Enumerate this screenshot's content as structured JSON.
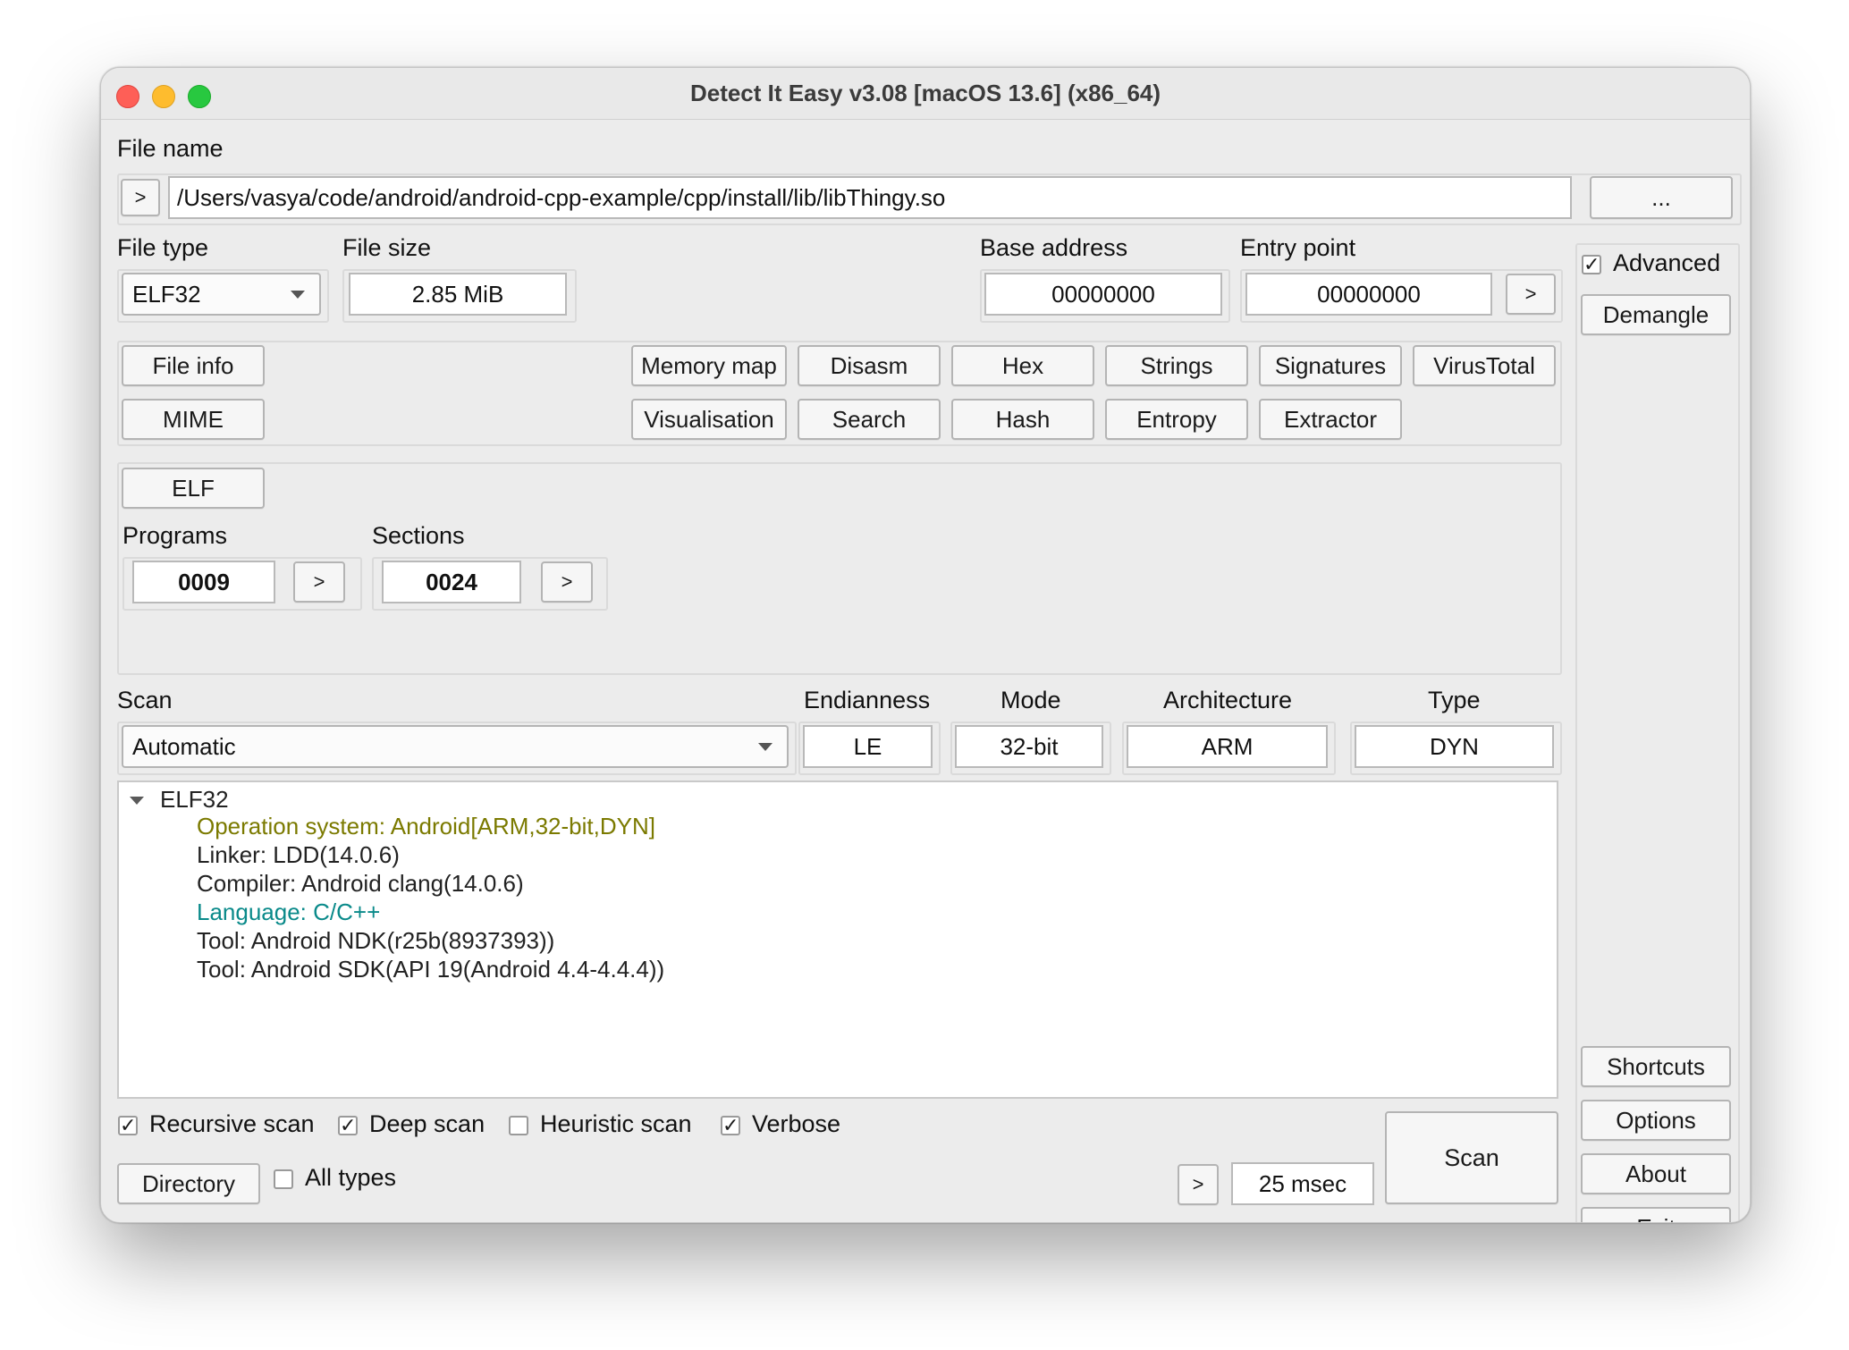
{
  "window": {
    "title": "Detect It Easy v3.08 [macOS 13.6] (x86_64)"
  },
  "file": {
    "label": "File name",
    "arrow_label": ">",
    "path": "/Users/vasya/code/android/android-cpp-example/cpp/install/lib/libThingy.so",
    "browse_label": "..."
  },
  "info": {
    "file_type_label": "File type",
    "file_type_value": "ELF32",
    "file_size_label": "File size",
    "file_size_value": "2.85 MiB",
    "base_address_label": "Base address",
    "base_address_value": "00000000",
    "entry_point_label": "Entry point",
    "entry_point_value": "00000000",
    "entry_arrow": ">"
  },
  "side": {
    "advanced_label": "Advanced",
    "advanced_checked": true,
    "demangle": "Demangle",
    "shortcuts": "Shortcuts",
    "options": "Options",
    "about": "About",
    "exit": "Exit"
  },
  "tools": {
    "file_info": "File info",
    "mime": "MIME",
    "memory_map": "Memory map",
    "disasm": "Disasm",
    "hex": "Hex",
    "strings": "Strings",
    "signatures": "Signatures",
    "virustotal": "VirusTotal",
    "visualisation": "Visualisation",
    "search": "Search",
    "hash": "Hash",
    "entropy": "Entropy",
    "extractor": "Extractor"
  },
  "elf": {
    "button": "ELF",
    "programs_label": "Programs",
    "programs_value": "0009",
    "programs_arrow": ">",
    "sections_label": "Sections",
    "sections_value": "0024",
    "sections_arrow": ">"
  },
  "scan": {
    "label": "Scan",
    "mode_value": "Automatic",
    "endianness_label": "Endianness",
    "endianness_value": "LE",
    "mode_label": "Mode",
    "bits_value": "32-bit",
    "architecture_label": "Architecture",
    "architecture_value": "ARM",
    "type_label": "Type",
    "type_value": "DYN"
  },
  "results": {
    "root": "ELF32",
    "items": [
      {
        "text": "Operation system: Android[ARM,32-bit,DYN]",
        "color": "#7b7a00"
      },
      {
        "text": "Linker: LDD(14.0.6)",
        "color": "#222222"
      },
      {
        "text": "Compiler: Android clang(14.0.6)",
        "color": "#222222"
      },
      {
        "text": "Language: C/C++",
        "color": "#0a8a8a"
      },
      {
        "text": "Tool: Android NDK(r25b(8937393))",
        "color": "#222222"
      },
      {
        "text": "Tool: Android SDK(API 19(Android 4.4-4.4.4))",
        "color": "#222222"
      }
    ]
  },
  "options": {
    "recursive": {
      "label": "Recursive scan",
      "checked": true
    },
    "deep": {
      "label": "Deep scan",
      "checked": true
    },
    "heuristic": {
      "label": "Heuristic scan",
      "checked": false
    },
    "verbose": {
      "label": "Verbose",
      "checked": true
    },
    "all_types": {
      "label": "All types",
      "checked": false
    }
  },
  "footer": {
    "directory": "Directory",
    "time_arrow": ">",
    "time": "25 msec",
    "scan_button": "Scan"
  }
}
